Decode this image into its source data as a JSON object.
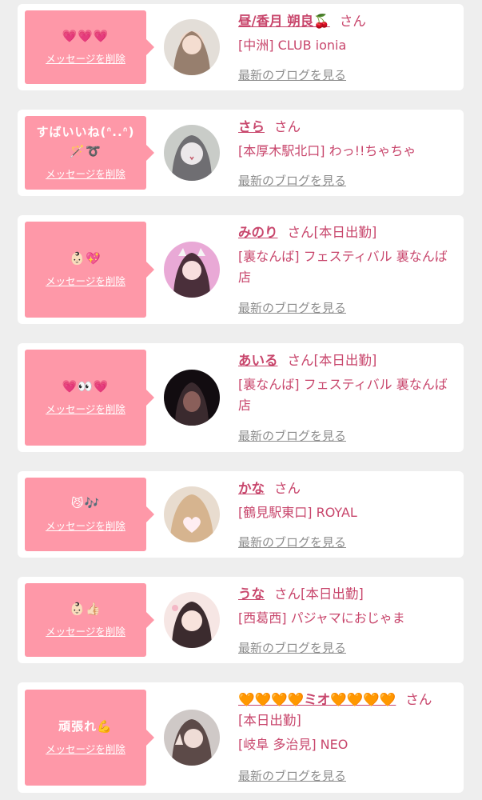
{
  "delete_label": "メッセージを削除",
  "blog_label": "最新のブログを見る",
  "san_label": "さん",
  "colors": {
    "bubble": "#fe98a8",
    "accent": "#c8466c",
    "link_gray": "#8d8d8d",
    "background": "#eeeeee"
  },
  "entries": [
    {
      "message": "💗💗💗",
      "name": "昼/香月 朔良🍒",
      "status": "",
      "shop": "[中洲] CLUB ionia",
      "avatar_icon": "avatar-photo-icon"
    },
    {
      "message": "すばいいね(ᐢ..ᐢ)🪄➰",
      "name": "さら",
      "status": "",
      "shop": "[本厚木駅北口] わっ!!ちゃちゃ",
      "avatar_icon": "avatar-photo-icon"
    },
    {
      "message": "👶🏻💖",
      "name": "みのり",
      "status": "[本日出勤]",
      "shop": "[裏なんば] フェスティバル 裏なんば店",
      "avatar_icon": "avatar-photo-icon"
    },
    {
      "message": "💗👀💗",
      "name": "あいる",
      "status": "[本日出勤]",
      "shop": "[裏なんば] フェスティバル 裏なんば店",
      "avatar_icon": "avatar-photo-icon"
    },
    {
      "message": "😼🎶",
      "name": "かな",
      "status": "",
      "shop": "[鶴見駅東口] ROYAL",
      "avatar_icon": "avatar-photo-icon"
    },
    {
      "message": "👶🏻👍🏻",
      "name": "うな",
      "status": "[本日出勤]",
      "shop": "[西葛西] パジャマにおじゃま",
      "avatar_icon": "avatar-photo-icon"
    },
    {
      "message": "頑張れ💪",
      "name": "🧡🧡🧡🧡ミオ🧡🧡🧡🧡",
      "status": "[本日出勤]",
      "shop": "[岐阜 多治見] NEO",
      "avatar_icon": "avatar-photo-icon"
    }
  ]
}
